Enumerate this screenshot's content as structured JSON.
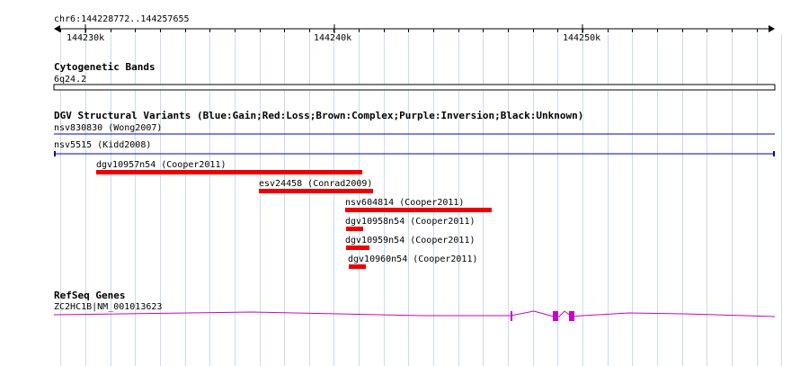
{
  "region": {
    "label": "chr6:144228772..144257655",
    "ticks": [
      "144230k",
      "144240k",
      "144250k"
    ]
  },
  "tracks": {
    "cytoband": {
      "title": "Cytogenetic Bands",
      "band": "6q24.2"
    },
    "dgv": {
      "title": "DGV Structural Variants (Blue:Gain;Red:Loss;Brown:Complex;Purple:Inversion;Black:Unknown)",
      "gain_color": "#0000cc",
      "loss_color": "#ee0000",
      "features": [
        {
          "label": "nsv830830 (Wong2007)",
          "type": "gain"
        },
        {
          "label": "nsv5515 (Kidd2008)",
          "type": "gain"
        },
        {
          "label": "dgv10957n54 (Cooper2011)",
          "type": "loss"
        },
        {
          "label": "esv24458 (Conrad2009)",
          "type": "loss"
        },
        {
          "label": "nsv604814 (Cooper2011)",
          "type": "loss"
        },
        {
          "label": "dgv10958n54 (Cooper2011)",
          "type": "loss"
        },
        {
          "label": "dgv10959n54 (Cooper2011)",
          "type": "loss"
        },
        {
          "label": "dgv10960n54 (Cooper2011)",
          "type": "loss"
        }
      ]
    },
    "refseq": {
      "title": "RefSeq Genes",
      "gene": "ZC2HC1B|NM_001013623",
      "color": "#cc00cc"
    }
  }
}
